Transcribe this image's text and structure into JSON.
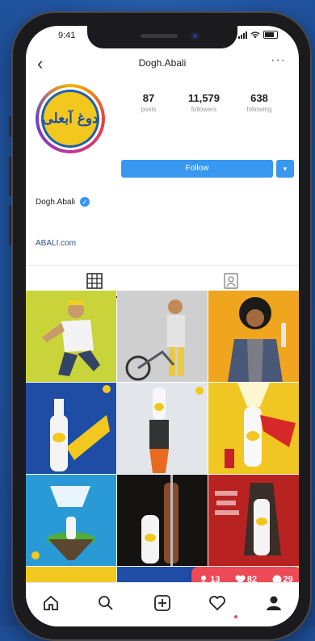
{
  "status": {
    "time": "9:41"
  },
  "header": {
    "username": "Dogh.Abali",
    "back_icon": "chevron-left-icon",
    "more_icon": "ellipsis-icon"
  },
  "profile": {
    "logo_text": "دوغ آبعلی",
    "name": "Dogh.Abali",
    "website": "ABALI.com",
    "follow_label": "Follow",
    "stats": [
      {
        "value": "87",
        "label": "posts"
      },
      {
        "value": "11,579",
        "label": "followers"
      },
      {
        "value": "638",
        "label": "following"
      }
    ]
  },
  "notification": {
    "follows": "13",
    "likes": "82",
    "comments": "29"
  },
  "colors": {
    "accent": "#3897f0",
    "notify": "#ed4956",
    "brand_yellow": "#f2c81e",
    "brand_blue": "#1f5fb0"
  }
}
